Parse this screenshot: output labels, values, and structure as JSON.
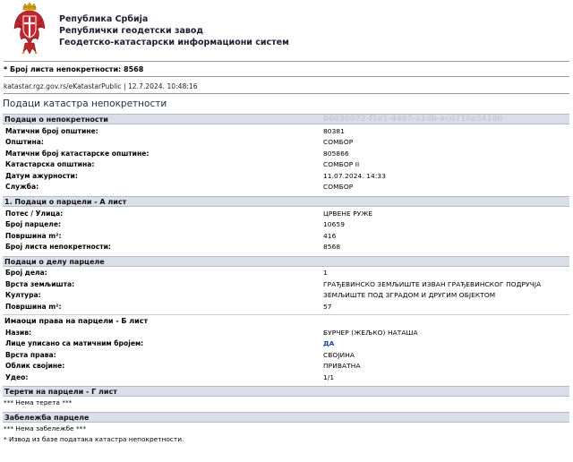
{
  "org": {
    "line1": "Република Србија",
    "line2": "Републички геодетски завод",
    "line3": "Геодетско-катастарски информациони систем"
  },
  "header_meta": {
    "property_sheet": "* Број листа непокретности: 8568",
    "source": "katastar.rgz.gov.rs/eKatastarPublic | 12.7.2024. 10:48:16"
  },
  "page_title": "Подаци катастра непокретности",
  "property": {
    "title": "Подаци о непокретности",
    "guid": "b0030072-f1e1-4407-a1db-acd710a5410b",
    "rows": [
      {
        "label": "Матични број општине:",
        "value": "80381"
      },
      {
        "label": "Општина:",
        "value": "СОМБОР"
      },
      {
        "label": "Матични број катастарске општине:",
        "value": "805866"
      },
      {
        "label": "Катастарска општина:",
        "value": "СОМБОР II"
      },
      {
        "label": "Датум ажурности:",
        "value": "11.07.2024. 14:33"
      },
      {
        "label": "Служба:",
        "value": "СОМБОР"
      }
    ]
  },
  "parcel": {
    "title": "1. Подаци о парцели - А лист",
    "rows": [
      {
        "label": "Потес / Улица:",
        "value": "ЦРВЕНЕ РУЖЕ"
      },
      {
        "label": "Број парцеле:",
        "value": "10659"
      },
      {
        "label": "Површина m²:",
        "value": "416"
      },
      {
        "label": "Број листа непокретности:",
        "value": "8568"
      }
    ]
  },
  "parcel_part": {
    "title": "Подаци о делу парцеле",
    "rows": [
      {
        "label": "Број дела:",
        "value": "1"
      },
      {
        "label": "Врста земљишта:",
        "value": "ГРАЂЕВИНСКО ЗЕМЉИШТЕ ИЗВАН ГРАЂЕВИНСКОГ ПОДРУЧЈА"
      },
      {
        "label": "Култура:",
        "value": "ЗЕМЉИШТЕ ПОД ЗГРАДОМ И ДРУГИМ ОБЈЕКТОМ"
      },
      {
        "label": "Површина m²:",
        "value": "57"
      }
    ]
  },
  "holders": {
    "title": "Имаоци права на парцели - Б лист",
    "rows": [
      {
        "label": "Назив:",
        "value": "БУРЧЕР (ЖЕЉКО) НАТАША"
      },
      {
        "label": "Лице уписано са матичним бројем:",
        "value": "ДА"
      },
      {
        "label": "Врста права:",
        "value": "СВОЈИНА"
      },
      {
        "label": "Облик својине:",
        "value": "ПРИВАТНА"
      },
      {
        "label": "Удео:",
        "value": "1/1"
      }
    ]
  },
  "burdens": {
    "title": "Терети на парцели - Г лист",
    "note": "*** Нема терета ***"
  },
  "remarks": {
    "title": "Забележба парцеле",
    "note": "*** Нема забележбе ***"
  },
  "footer": "* Извод из базе података катастра непокретности.",
  "colors": {
    "section_bg": "#d9dee8",
    "title": "#1d2b4a",
    "link_blue": "#1a3fb0"
  }
}
